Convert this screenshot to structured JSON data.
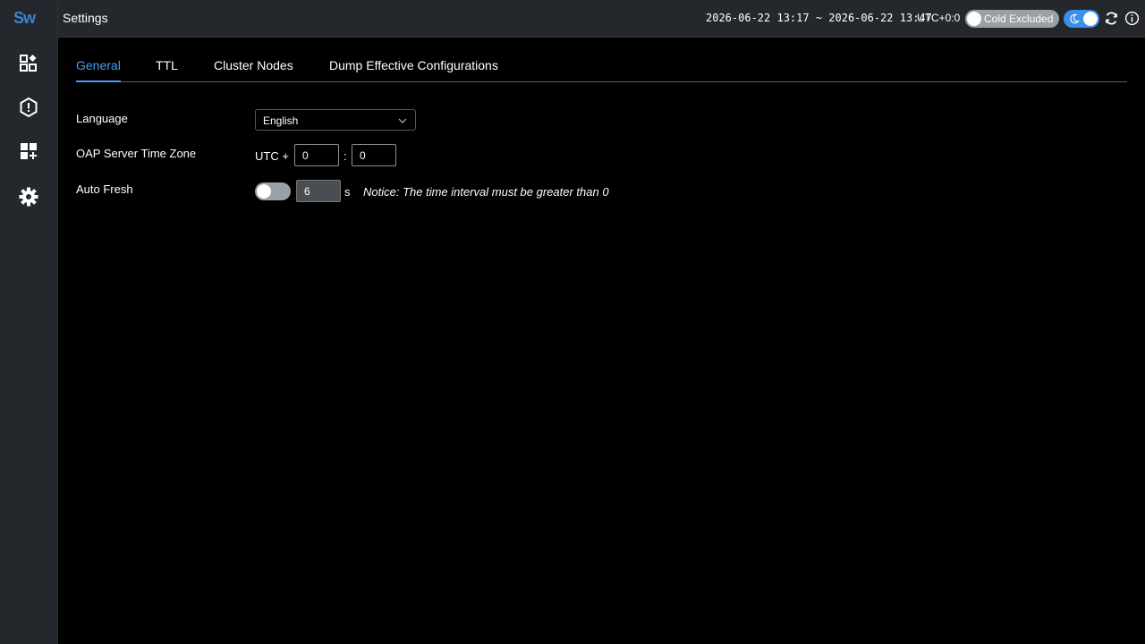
{
  "app": {
    "logo_text": "Sw",
    "brand_color": "#3b82d6"
  },
  "sidebar": {
    "items": [
      {
        "icon": "dashboard-icon",
        "label": "Dashboards"
      },
      {
        "icon": "alert-icon",
        "label": "Alerting"
      },
      {
        "icon": "add-widget-icon",
        "label": "Marketplace"
      },
      {
        "icon": "gear-icon",
        "label": "Settings"
      }
    ]
  },
  "header": {
    "title": "Settings",
    "time_range": "2026-06-22 13:17 ~ 2026-06-22 13:47",
    "timezone": "UTC+0:0",
    "cold_toggle_label": "Cold Excluded",
    "cold_toggle_on": false,
    "dark_mode_on": true,
    "icons": [
      "refresh-icon",
      "info-icon"
    ]
  },
  "tabs": [
    {
      "label": "General",
      "active": true
    },
    {
      "label": "TTL",
      "active": false
    },
    {
      "label": "Cluster Nodes",
      "active": false
    },
    {
      "label": "Dump Effective Configurations",
      "active": false
    }
  ],
  "settings": {
    "language_label": "Language",
    "language_value": "English",
    "timezone_label": "OAP Server Time Zone",
    "utc_prefix": "UTC +",
    "utc_hours": "0",
    "utc_separator": ":",
    "utc_minutes": "0",
    "auto_fresh_label": "Auto Fresh",
    "auto_fresh_on": false,
    "auto_fresh_interval": "6",
    "auto_fresh_unit": "s",
    "auto_fresh_notice": "Notice: The time interval must be greater than 0"
  },
  "colors": {
    "accent": "#4c9bf5",
    "toggle_on": "#3b8fe8",
    "toggle_off": "#9aa0a6"
  }
}
